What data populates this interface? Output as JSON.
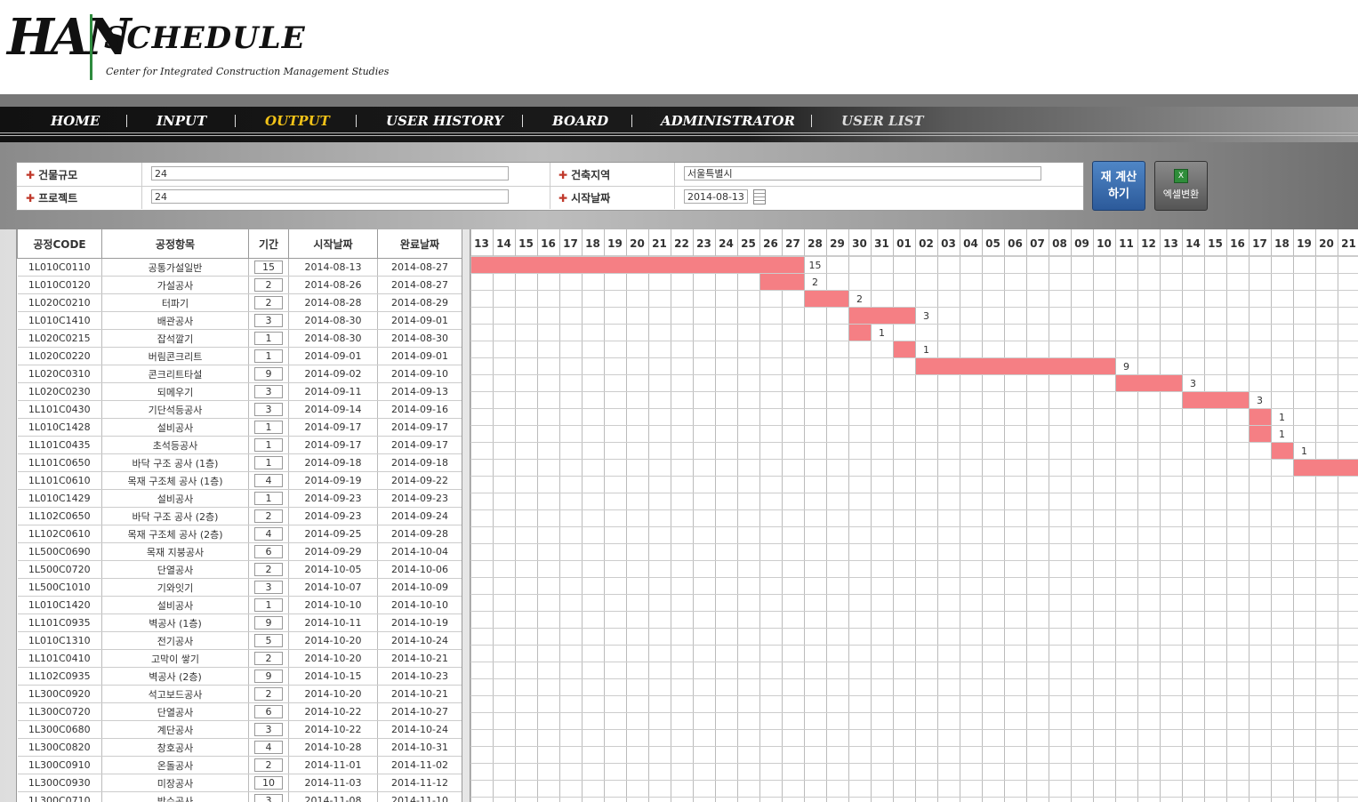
{
  "logo": {
    "han": "HAN",
    "schedule": "SCHEDULE",
    "subtitle": "Center for Integrated Construction Management Studies"
  },
  "nav": [
    {
      "label": "HOME",
      "state": "normal"
    },
    {
      "label": "INPUT",
      "state": "normal"
    },
    {
      "label": "OUTPUT",
      "state": "active"
    },
    {
      "label": "USER HISTORY",
      "state": "normal"
    },
    {
      "label": "BOARD",
      "state": "normal"
    },
    {
      "label": "ADMINISTRATOR",
      "state": "normal"
    },
    {
      "label": "USER LIST",
      "state": "dim"
    }
  ],
  "form": {
    "building_scale_label": "건물규모",
    "building_scale_value": "24",
    "project_label": "프로젝트",
    "project_value": "24",
    "region_label": "건축지역",
    "region_value": "서울특별시",
    "start_date_label": "시작날짜",
    "start_date_value": "2014-08-13"
  },
  "buttons": {
    "recalc_line1": "재 계산",
    "recalc_line2": "하기",
    "excel": "엑셀변환"
  },
  "table": {
    "headers": [
      "공정CODE",
      "공정항목",
      "기간",
      "시작날짜",
      "완료날짜"
    ],
    "rows": [
      [
        "1L010C0110",
        "공통가설일반",
        "15",
        "2014-08-13",
        "2014-08-27"
      ],
      [
        "1L010C0120",
        "가설공사",
        "2",
        "2014-08-26",
        "2014-08-27"
      ],
      [
        "1L020C0210",
        "터파기",
        "2",
        "2014-08-28",
        "2014-08-29"
      ],
      [
        "1L010C1410",
        "배관공사",
        "3",
        "2014-08-30",
        "2014-09-01"
      ],
      [
        "1L020C0215",
        "잡석깔기",
        "1",
        "2014-08-30",
        "2014-08-30"
      ],
      [
        "1L020C0220",
        "버림콘크리트",
        "1",
        "2014-09-01",
        "2014-09-01"
      ],
      [
        "1L020C0310",
        "콘크리트타설",
        "9",
        "2014-09-02",
        "2014-09-10"
      ],
      [
        "1L020C0230",
        "되메우기",
        "3",
        "2014-09-11",
        "2014-09-13"
      ],
      [
        "1L101C0430",
        "기단석등공사",
        "3",
        "2014-09-14",
        "2014-09-16"
      ],
      [
        "1L010C1428",
        "설비공사",
        "1",
        "2014-09-17",
        "2014-09-17"
      ],
      [
        "1L101C0435",
        "초석등공사",
        "1",
        "2014-09-17",
        "2014-09-17"
      ],
      [
        "1L101C0650",
        "바닥 구조 공사 (1층)",
        "1",
        "2014-09-18",
        "2014-09-18"
      ],
      [
        "1L101C0610",
        "목재 구조체 공사 (1층)",
        "4",
        "2014-09-19",
        "2014-09-22"
      ],
      [
        "1L010C1429",
        "설비공사",
        "1",
        "2014-09-23",
        "2014-09-23"
      ],
      [
        "1L102C0650",
        "바닥 구조 공사 (2층)",
        "2",
        "2014-09-23",
        "2014-09-24"
      ],
      [
        "1L102C0610",
        "목재 구조체 공사 (2층)",
        "4",
        "2014-09-25",
        "2014-09-28"
      ],
      [
        "1L500C0690",
        "목재 지붕공사",
        "6",
        "2014-09-29",
        "2014-10-04"
      ],
      [
        "1L500C0720",
        "단열공사",
        "2",
        "2014-10-05",
        "2014-10-06"
      ],
      [
        "1L500C1010",
        "기와잇기",
        "3",
        "2014-10-07",
        "2014-10-09"
      ],
      [
        "1L010C1420",
        "설비공사",
        "1",
        "2014-10-10",
        "2014-10-10"
      ],
      [
        "1L101C0935",
        "벽공사 (1층)",
        "9",
        "2014-10-11",
        "2014-10-19"
      ],
      [
        "1L010C1310",
        "전기공사",
        "5",
        "2014-10-20",
        "2014-10-24"
      ],
      [
        "1L101C0410",
        "고막이 쌓기",
        "2",
        "2014-10-20",
        "2014-10-21"
      ],
      [
        "1L102C0935",
        "벽공사 (2층)",
        "9",
        "2014-10-15",
        "2014-10-23"
      ],
      [
        "1L300C0920",
        "석고보드공사",
        "2",
        "2014-10-20",
        "2014-10-21"
      ],
      [
        "1L300C0720",
        "단열공사",
        "6",
        "2014-10-22",
        "2014-10-27"
      ],
      [
        "1L300C0680",
        "계단공사",
        "3",
        "2014-10-22",
        "2014-10-24"
      ],
      [
        "1L300C0820",
        "창호공사",
        "4",
        "2014-10-28",
        "2014-10-31"
      ],
      [
        "1L300C0910",
        "온돌공사",
        "2",
        "2014-11-01",
        "2014-11-02"
      ],
      [
        "1L300C0930",
        "미장공사",
        "10",
        "2014-11-03",
        "2014-11-12"
      ],
      [
        "1L300C0710",
        "방수공사",
        "3",
        "2014-11-08",
        "2014-11-10"
      ]
    ]
  },
  "gantt": {
    "days": [
      "13",
      "14",
      "15",
      "16",
      "17",
      "18",
      "19",
      "20",
      "21",
      "22",
      "23",
      "24",
      "25",
      "26",
      "27",
      "28",
      "29",
      "30",
      "31",
      "01",
      "02",
      "03",
      "04",
      "05",
      "06",
      "07",
      "08",
      "09",
      "10",
      "11",
      "12",
      "13",
      "14",
      "15",
      "16",
      "17",
      "18",
      "19",
      "20",
      "21"
    ],
    "bars": [
      {
        "start": 0,
        "len": 15,
        "label": "15"
      },
      {
        "start": 13,
        "len": 2,
        "label": "2"
      },
      {
        "start": 15,
        "len": 2,
        "label": "2"
      },
      {
        "start": 17,
        "len": 3,
        "label": "3"
      },
      {
        "start": 17,
        "len": 1,
        "label": "1"
      },
      {
        "start": 19,
        "len": 1,
        "label": "1"
      },
      {
        "start": 20,
        "len": 9,
        "label": "9"
      },
      {
        "start": 29,
        "len": 3,
        "label": "3"
      },
      {
        "start": 32,
        "len": 3,
        "label": "3"
      },
      {
        "start": 35,
        "len": 1,
        "label": "1"
      },
      {
        "start": 35,
        "len": 1,
        "label": "1"
      },
      {
        "start": 36,
        "len": 1,
        "label": "1"
      },
      {
        "start": 37,
        "len": 4,
        "label": ""
      }
    ],
    "bar_color": "#f57f84"
  }
}
